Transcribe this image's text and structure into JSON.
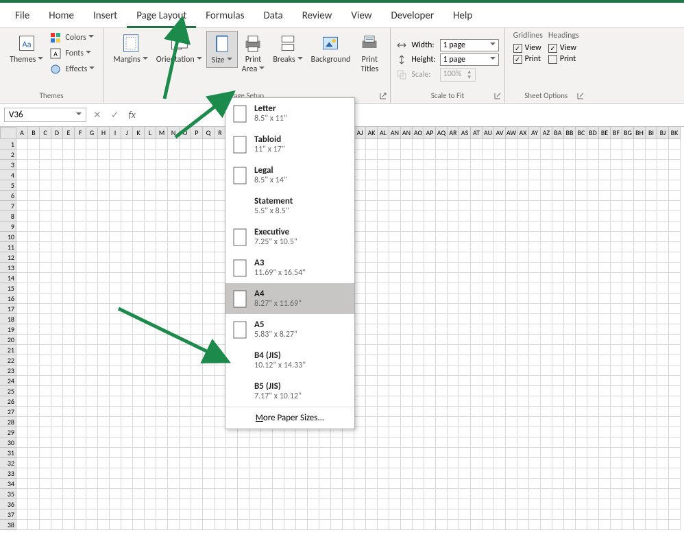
{
  "menu": {
    "tabs": [
      "File",
      "Home",
      "Insert",
      "Page Layout",
      "Formulas",
      "Data",
      "Review",
      "View",
      "Developer",
      "Help"
    ],
    "active": "Page Layout"
  },
  "ribbon": {
    "themes": {
      "label": "Themes",
      "btn": "Themes",
      "colors": "Colors",
      "fonts": "Fonts",
      "effects": "Effects"
    },
    "page_setup": {
      "label": "Page Setup",
      "margins": "Margins",
      "orientation": "Orientation",
      "size": "Size",
      "print_area": "Print\nArea",
      "breaks": "Breaks",
      "background": "Background",
      "print_titles": "Print\nTitles"
    },
    "scale": {
      "label": "Scale to Fit",
      "width_lbl": "Width:",
      "height_lbl": "Height:",
      "scale_lbl": "Scale:",
      "width_val": "1 page",
      "height_val": "1 page",
      "scale_val": "100%"
    },
    "sheet": {
      "label": "Sheet Options",
      "gridlines": "Gridlines",
      "headings": "Headings",
      "view": "View",
      "print": "Print"
    }
  },
  "namebox": "V36",
  "size_menu": {
    "items": [
      {
        "name": "Letter",
        "dim": "8.5\" x 11\"",
        "icon": true
      },
      {
        "name": "Tabloid",
        "dim": "11\" x 17\"",
        "icon": true
      },
      {
        "name": "Legal",
        "dim": "8.5\" x 14\"",
        "icon": true
      },
      {
        "name": "Statement",
        "dim": "5.5\" x 8.5\"",
        "icon": false
      },
      {
        "name": "Executive",
        "dim": "7.25\" x 10.5\"",
        "icon": true
      },
      {
        "name": "A3",
        "dim": "11.69\" x 16.54\"",
        "icon": true
      },
      {
        "name": "A4",
        "dim": "8.27\" x 11.69\"",
        "icon": true,
        "selected": true
      },
      {
        "name": "A5",
        "dim": "5.83\" x 8.27\"",
        "icon": true
      },
      {
        "name": "B4 (JIS)",
        "dim": "10.12\" x 14.33\"",
        "icon": false
      },
      {
        "name": "B5 (JIS)",
        "dim": "7.17\" x 10.12\"",
        "icon": false
      }
    ],
    "more_pre": "M",
    "more_post": "ore Paper Sizes..."
  },
  "columns": [
    "A",
    "B",
    "C",
    "D",
    "E",
    "F",
    "G",
    "H",
    "I",
    "J",
    "K",
    "L",
    "M",
    "N",
    "O",
    "P",
    "Q",
    "R",
    "",
    "",
    "",
    "",
    "",
    "",
    "",
    "",
    "",
    "",
    "",
    "AJ",
    "AK",
    "AL",
    "AN",
    "AN",
    "AO",
    "AP",
    "AQ",
    "AR",
    "AS",
    "AT",
    "AU",
    "AV",
    "AW",
    "AX",
    "AY",
    "AZ",
    "BA",
    "BB",
    "BC",
    "BD",
    "BE",
    "BF",
    "BG",
    "BH",
    "BI",
    "BJ",
    "BK"
  ],
  "rows": 38
}
